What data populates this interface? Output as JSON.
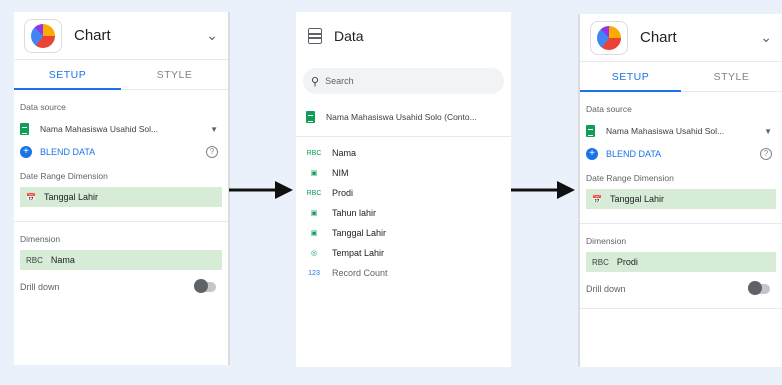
{
  "left_panel": {
    "title": "Chart",
    "tabs": [
      "SETUP",
      "STYLE"
    ],
    "data_source_label": "Data source",
    "data_source_name": "Nama Mahasiswa Usahid Sol...",
    "blend_label": "BLEND DATA",
    "date_range_label": "Date Range Dimension",
    "date_range_field": "Tanggal Lahir",
    "dimension_label": "Dimension",
    "dimension_field": "Nama",
    "drill_label": "Drill down"
  },
  "data_panel": {
    "title": "Data",
    "search_placeholder": "Search",
    "source_name": "Nama Mahasiswa Usahid Solo (Conto...",
    "fields": [
      {
        "icon": "RBC",
        "name": "Nama"
      },
      {
        "icon": "cal",
        "name": "NIM"
      },
      {
        "icon": "RBC",
        "name": "Prodi"
      },
      {
        "icon": "cal",
        "name": "Tahun lahir"
      },
      {
        "icon": "cal",
        "name": "Tanggal Lahir"
      },
      {
        "icon": "geo",
        "name": "Tempat Lahir"
      },
      {
        "icon": "123",
        "name": "Record Count"
      }
    ]
  },
  "right_panel": {
    "title": "Chart",
    "tabs": [
      "SETUP",
      "STYLE"
    ],
    "data_source_label": "Data source",
    "data_source_name": "Nama Mahasiswa Usahid Sol...",
    "blend_label": "BLEND DATA",
    "date_range_label": "Date Range Dimension",
    "date_range_field": "Tanggal Lahir",
    "dimension_label": "Dimension",
    "dimension_field": "Prodi",
    "drill_label": "Drill down"
  },
  "colors": {
    "accent": "#1a73e8",
    "chip": "#d7ecd7",
    "sheet": "#0f9d58",
    "background": "#eaf1fb"
  }
}
